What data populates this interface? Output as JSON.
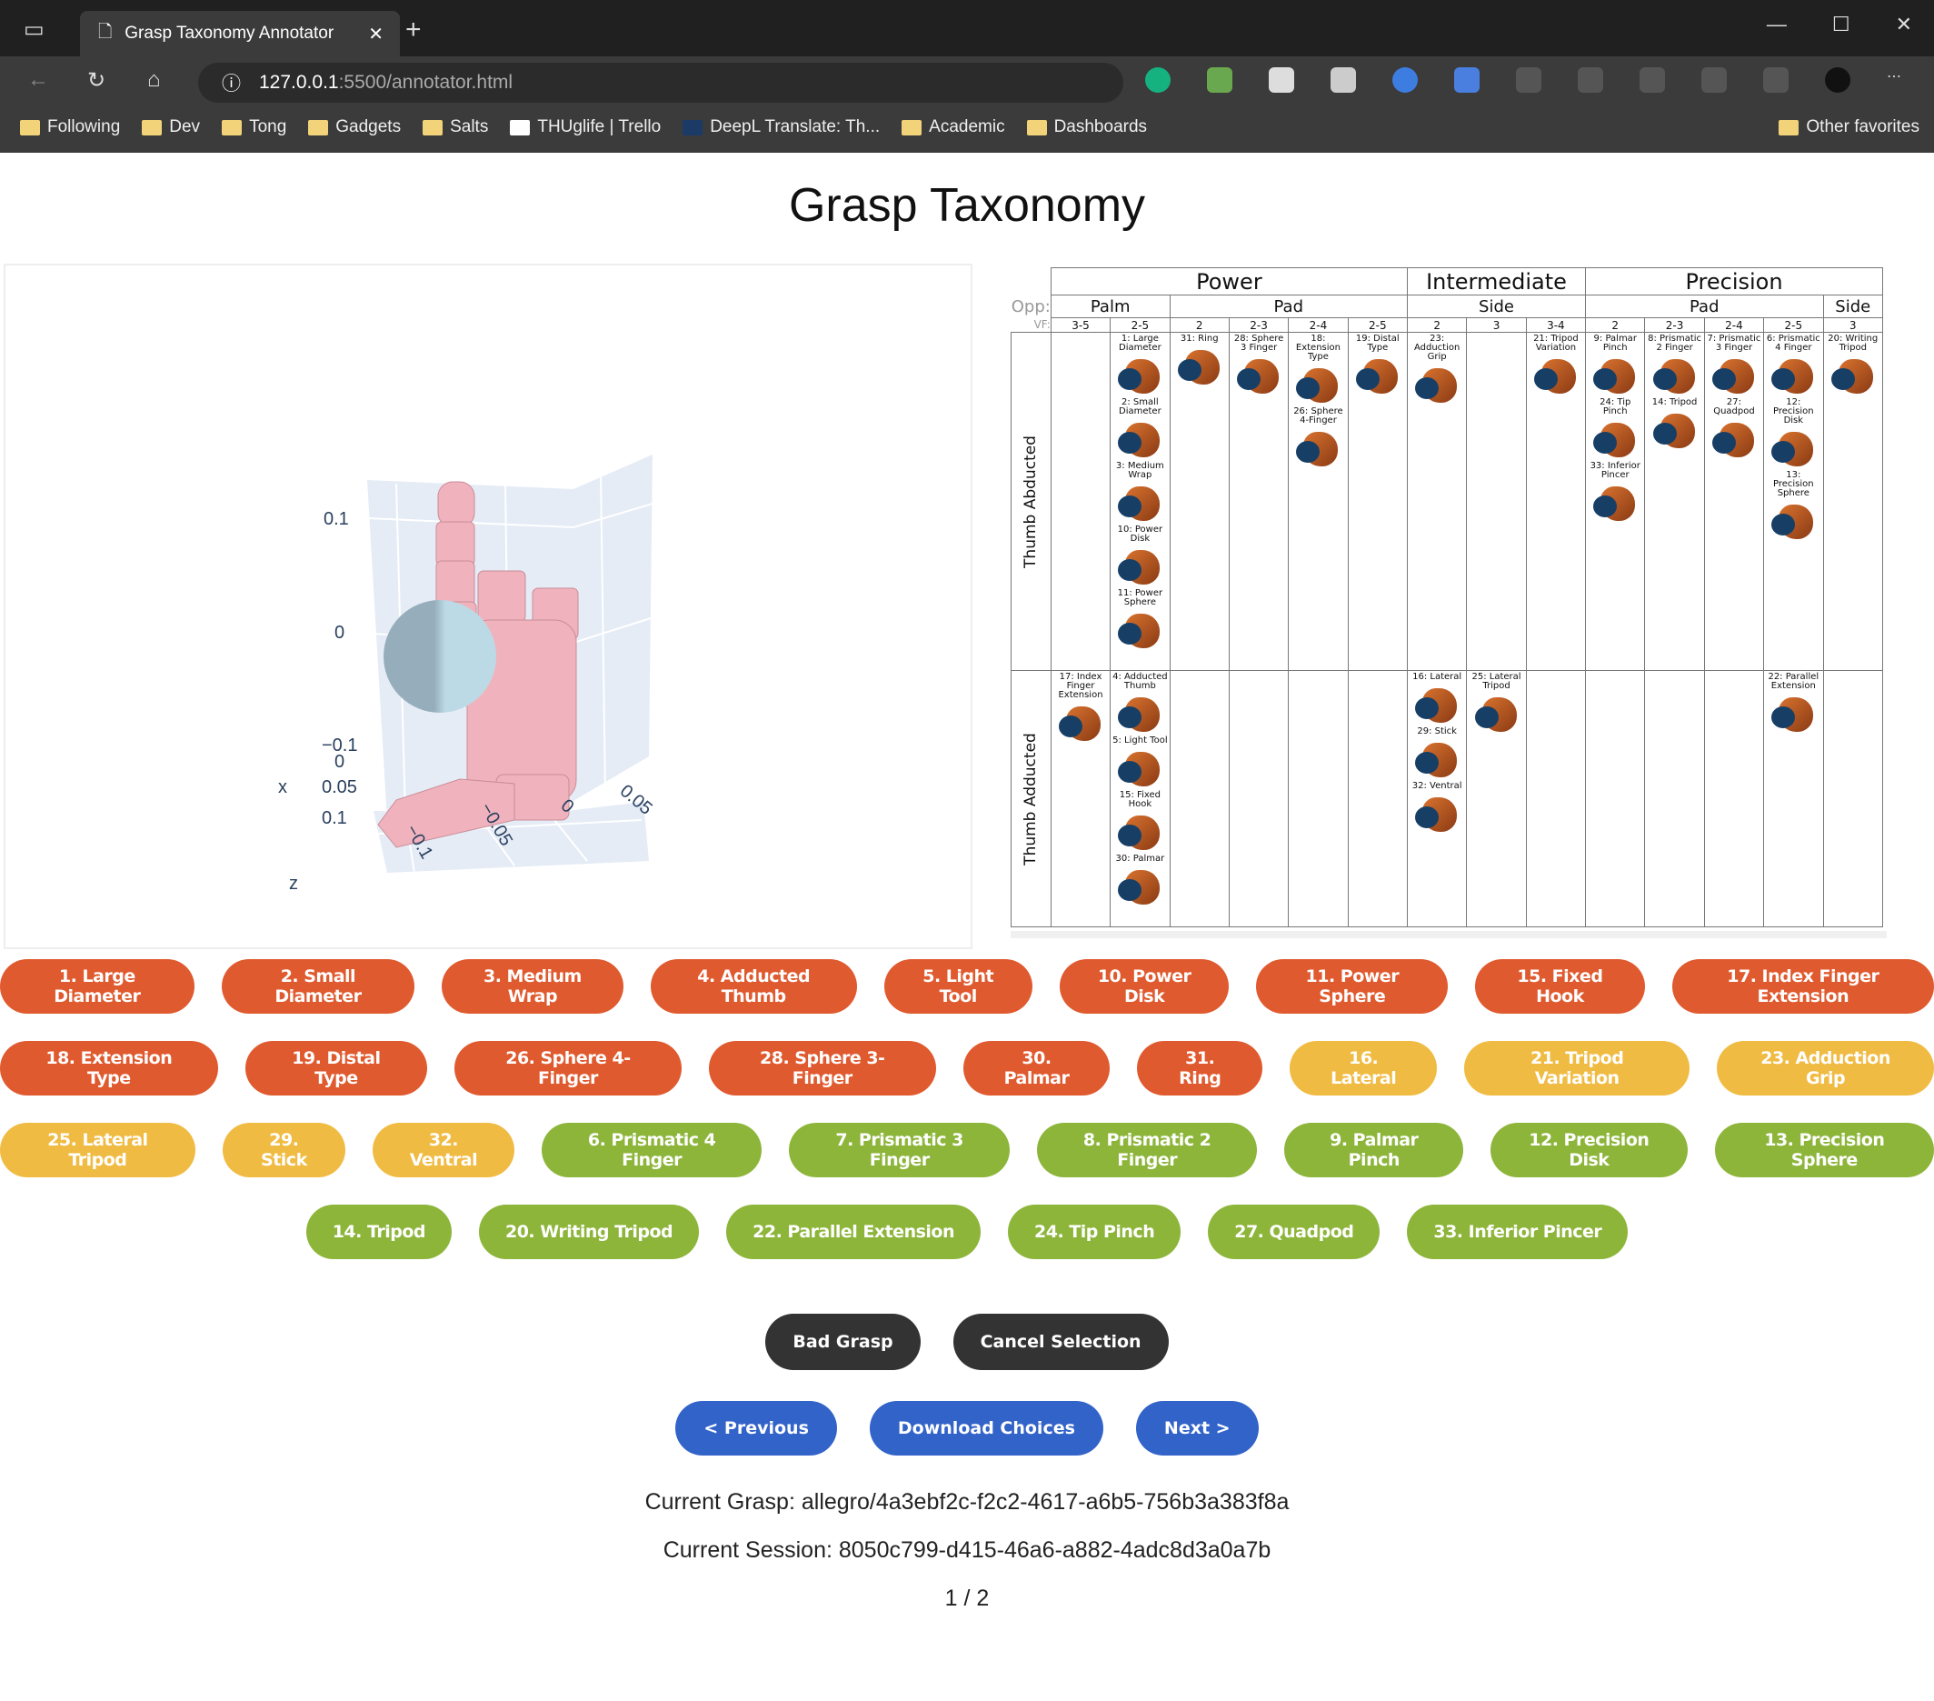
{
  "browser": {
    "tab_title": "Grasp Taxonomy Annotator",
    "url_host": "127.0.0.1",
    "url_rest": ":5500/annotator.html",
    "bookmarks": [
      "Following",
      "Dev",
      "Tong",
      "Gadgets",
      "Salts",
      "THUglife | Trello",
      "DeepL Translate: Th...",
      "Academic",
      "Dashboards"
    ],
    "other_favorites": "Other favorites"
  },
  "page": {
    "title": "Grasp Taxonomy"
  },
  "plot": {
    "z_label": "z",
    "x_label": "x",
    "z_ticks": [
      "0.1",
      "0",
      "−0.1"
    ],
    "x_ticks": [
      "0",
      "0.05",
      "0.1"
    ],
    "y_ticks": [
      "−0.1",
      "−0.05",
      "0",
      "0.05"
    ],
    "hand_color": "#f0b3bd",
    "object_color": "#add8e6",
    "pane_color": "#e5ecf6"
  },
  "taxonomy": {
    "top": [
      {
        "label": "Power",
        "span": 6
      },
      {
        "label": "Intermediate",
        "span": 3
      },
      {
        "label": "Precision",
        "span": 5
      }
    ],
    "opp_label": "Opp:",
    "opp": [
      {
        "label": "Palm",
        "span": 2
      },
      {
        "label": "Pad",
        "span": 4
      },
      {
        "label": "Side",
        "span": 3
      },
      {
        "label": "Pad",
        "span": 4
      },
      {
        "label": "Side",
        "span": 1
      }
    ],
    "vf_label": "VF:",
    "vf": [
      "3-5",
      "2-5",
      "2",
      "2-3",
      "2-4",
      "2-5",
      "2",
      "3",
      "3-4",
      "2",
      "2-3",
      "2-4",
      "2-5",
      "3"
    ],
    "rows": [
      {
        "label": "Thumb Abducted",
        "cells": [
          [],
          [
            "1: Large Diameter",
            "2: Small Diameter",
            "3: Medium Wrap",
            "10: Power Disk",
            "11: Power Sphere"
          ],
          [
            "31: Ring"
          ],
          [
            "28: Sphere 3 Finger"
          ],
          [
            "18: Extension Type",
            "26: Sphere 4-Finger"
          ],
          [
            "19: Distal Type"
          ],
          [
            "23: Adduction Grip"
          ],
          [],
          [
            "21: Tripod Variation"
          ],
          [
            "9: Palmar Pinch",
            "24: Tip Pinch",
            "33: Inferior Pincer"
          ],
          [
            "8: Prismatic 2 Finger",
            "14: Tripod"
          ],
          [
            "7: Prismatic 3 Finger",
            "27: Quadpod"
          ],
          [
            "6: Prismatic 4 Finger",
            "12: Precision Disk",
            "13: Precision Sphere"
          ],
          [
            "20: Writing Tripod"
          ]
        ]
      },
      {
        "label": "Thumb Adducted",
        "cells": [
          [
            "17: Index Finger Extension"
          ],
          [
            "4: Adducted Thumb",
            "5: Light Tool",
            "15: Fixed Hook",
            "30: Palmar"
          ],
          [],
          [],
          [],
          [],
          [
            "16: Lateral",
            "29: Stick",
            "32: Ventral"
          ],
          [
            "25: Lateral Tripod"
          ],
          [],
          [],
          [],
          [],
          [
            "22: Parallel Extension"
          ],
          []
        ]
      }
    ]
  },
  "grasp_buttons": [
    [
      {
        "label": "1. Large Diameter",
        "group": "red"
      },
      {
        "label": "2. Small Diameter",
        "group": "red"
      },
      {
        "label": "3. Medium Wrap",
        "group": "red"
      },
      {
        "label": "4. Adducted Thumb",
        "group": "red"
      },
      {
        "label": "5. Light Tool",
        "group": "red"
      },
      {
        "label": "10. Power Disk",
        "group": "red"
      },
      {
        "label": "11. Power Sphere",
        "group": "red"
      },
      {
        "label": "15. Fixed Hook",
        "group": "red"
      },
      {
        "label": "17. Index Finger Extension",
        "group": "red"
      }
    ],
    [
      {
        "label": "18. Extension Type",
        "group": "red"
      },
      {
        "label": "19. Distal Type",
        "group": "red"
      },
      {
        "label": "26. Sphere 4-Finger",
        "group": "red"
      },
      {
        "label": "28. Sphere 3-Finger",
        "group": "red"
      },
      {
        "label": "30. Palmar",
        "group": "red"
      },
      {
        "label": "31. Ring",
        "group": "red"
      },
      {
        "label": "16. Lateral",
        "group": "yellow"
      },
      {
        "label": "21. Tripod Variation",
        "group": "yellow"
      },
      {
        "label": "23. Adduction Grip",
        "group": "yellow"
      }
    ],
    [
      {
        "label": "25. Lateral Tripod",
        "group": "yellow"
      },
      {
        "label": "29. Stick",
        "group": "yellow"
      },
      {
        "label": "32. Ventral",
        "group": "yellow"
      },
      {
        "label": "6. Prismatic 4 Finger",
        "group": "green"
      },
      {
        "label": "7. Prismatic 3 Finger",
        "group": "green"
      },
      {
        "label": "8. Prismatic 2 Finger",
        "group": "green"
      },
      {
        "label": "9. Palmar Pinch",
        "group": "green"
      },
      {
        "label": "12. Precision Disk",
        "group": "green"
      },
      {
        "label": "13. Precision Sphere",
        "group": "green"
      }
    ],
    [
      {
        "label": "14. Tripod",
        "group": "green"
      },
      {
        "label": "20. Writing Tripod",
        "group": "green"
      },
      {
        "label": "22. Parallel Extension",
        "group": "green"
      },
      {
        "label": "24. Tip Pinch",
        "group": "green"
      },
      {
        "label": "27. Quadpod",
        "group": "green"
      },
      {
        "label": "33. Inferior Pincer",
        "group": "green"
      }
    ]
  ],
  "group_colors": {
    "red": "#e05a2f",
    "yellow": "#f0bb42",
    "green": "#8db53a"
  },
  "controls": {
    "bad_grasp": "Bad Grasp",
    "cancel": "Cancel Selection",
    "previous": "< Previous",
    "download": "Download Choices",
    "next": "Next >"
  },
  "status": {
    "current_grasp": "Current Grasp: allegro/4a3ebf2c-f2c2-4617-a6b5-756b3a383f8a",
    "current_session": "Current Session: 8050c799-d415-46a6-a882-4adc8d3a0a7b",
    "page_counter": "1 / 2"
  }
}
